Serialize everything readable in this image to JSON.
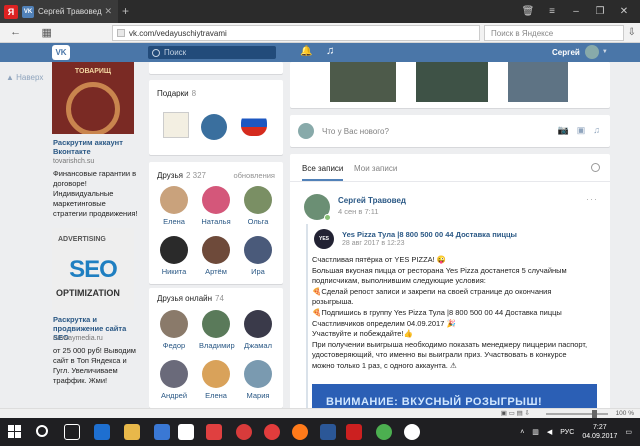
{
  "browser": {
    "tab_title": "Сергей Травовед",
    "url": "vk.com/vedayuschiytravami",
    "search_placeholder": "Поиск в Яндексе",
    "yandex_letter": "Я",
    "vk_favicon": "VK"
  },
  "vk_header": {
    "logo": "VK",
    "search_placeholder": "Поиск",
    "user_name": "Сергей"
  },
  "left_ads": {
    "up_label": "Наверх",
    "ad1": {
      "image_text": "ТОВАРИЩ",
      "title": "Раскрутим аккаунт Вконтакте",
      "site": "tovarishch.su",
      "text": "Финансовые гарантии в договоре! Индивидуальные маркетинговые стратегии продвижения!"
    },
    "ad2": {
      "image_top": "ADVERTISING",
      "image_main": "SEO",
      "image_bottom": "OPTIMIZATION",
      "title": "Раскрутка и продвижение сайта SEO",
      "site": "runwaymedia.ru",
      "text": "от 25 000 руб! Выводим сайт в Топ Яндекса и Гугл. Увеличиваем траффик. Жми!"
    }
  },
  "gifts": {
    "title": "Подарки",
    "count": "8"
  },
  "friends": {
    "title": "Друзья",
    "count": "2 327",
    "updates": "обновления",
    "items": [
      {
        "name": "Елена",
        "color": "#c9a27c"
      },
      {
        "name": "Наталья",
        "color": "#d4577a"
      },
      {
        "name": "Ольга",
        "color": "#7a8f64"
      },
      {
        "name": "Никита",
        "color": "#2a2a2a"
      },
      {
        "name": "Артём",
        "color": "#6e4a3a"
      },
      {
        "name": "Ира",
        "color": "#4a5a7a"
      }
    ]
  },
  "online": {
    "title": "Друзья онлайн",
    "count": "74",
    "items": [
      {
        "name": "Федор",
        "color": "#8a7a6a"
      },
      {
        "name": "Владимир",
        "color": "#5a7a5a"
      },
      {
        "name": "Джамал",
        "color": "#3a3a4a"
      },
      {
        "name": "Андрей",
        "color": "#6a6a7a"
      },
      {
        "name": "Елена",
        "color": "#d9a25a"
      },
      {
        "name": "Мария",
        "color": "#7a9ab0"
      }
    ]
  },
  "composer": {
    "placeholder": "Что у Вас нового?"
  },
  "wall": {
    "tab_all": "Все записи",
    "tab_mine": "Мои записи",
    "post_author": "Сергей Травовед",
    "post_date": "4 сен в 7:11",
    "repost_avatar_text": "YES",
    "repost_author": "Yes Pizza Тула |8 800 500 00 44 Доставка пиццы",
    "repost_date": "28 авг 2017 в 12:23",
    "lines": [
      "Счастливая пятёрка от YES PIZZA! 😜",
      "Большая вкусная пицца от ресторана Yes Pizza достанется 5 случайным",
      "подписчикам, выполнившим следующие условия:",
      "🍕Сделай репост записи и закрепи на своей странице до окончания",
      "розыгрыша.",
      "🍕Подпишись в группу Yes Pizza Тула |8 800 500 00 44 Доставка пиццы",
      "Счастливчиков определим 04.09.2017 🎉",
      "Участвуйте и побеждайте!👍",
      "При получении выигрыша необходимо показать менеджеру пиццерии паспорт,",
      "удостоверяющий, что именно вы выиграли приз. Участвовать в конкурсе",
      "можно только 1 раз, с одного аккаунта. ⚠"
    ],
    "banner": "ВНИМАНИЕ: ВКУСНЫЙ РОЗЫГРЫШ!"
  },
  "statusbar": {
    "zoom": "100 %"
  },
  "taskbar": {
    "lang": "РУС",
    "time": "7:27",
    "date": "04.09.2017"
  }
}
